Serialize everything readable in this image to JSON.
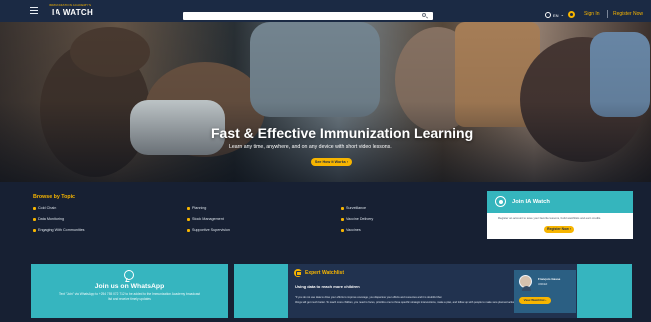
{
  "nav": {
    "logo_top": "IMMUNIZATION ACADEMY'S",
    "logo_main": "IA WATCH",
    "search_value": "",
    "language": "EN",
    "sign_in": "Sign In",
    "register": "Register Now"
  },
  "hero": {
    "title": "Fast & Effective Immunization Learning",
    "subtitle": "Learn any time, anywhere, and on any device with short video lessons.",
    "button": "See How it Works"
  },
  "browse": {
    "title": "Browse by Topic",
    "topics": [
      "Cold Chain",
      "Data Monitoring",
      "Engaging With Communities",
      "Planning",
      "Stock Management",
      "Supportive Supervision",
      "Surveillance",
      "Vaccine Delivery",
      "Vaccines"
    ]
  },
  "join": {
    "title": "Join IA Watch",
    "text": "Register an account to save your favorite lessons, build watchlists and earn credits.",
    "button": "Register Now"
  },
  "whatsapp": {
    "title": "Join us on WhatsApp",
    "text_line1": "Text \"Join\" via WhatsApp to +254 755 072 712 to be added to the Immunization Academy broadcast",
    "text_line2": "list and receive timely updates"
  },
  "expert": {
    "label": "Expert Watchlist",
    "subtitle": "Using data to reach more children",
    "quote_line1": "\"If you do not use data to drive your efforts to improve coverage, you dispersive your efforts and resources and it is doubtful that",
    "quote_line2": "things will get much better. To reach more children, you need to focus, prioritize one to three specific strategic interventions, make a plan, and follow up with people to make sure planned actions are executed. These videos can help guide you.\"",
    "person_name": "François Gasse",
    "person_org": "UNICEF",
    "button": "View Watchlist"
  },
  "colors": {
    "brand_navy": "#1b2a44",
    "accent_gold": "#f7b500",
    "teal": "#36b5bf"
  }
}
